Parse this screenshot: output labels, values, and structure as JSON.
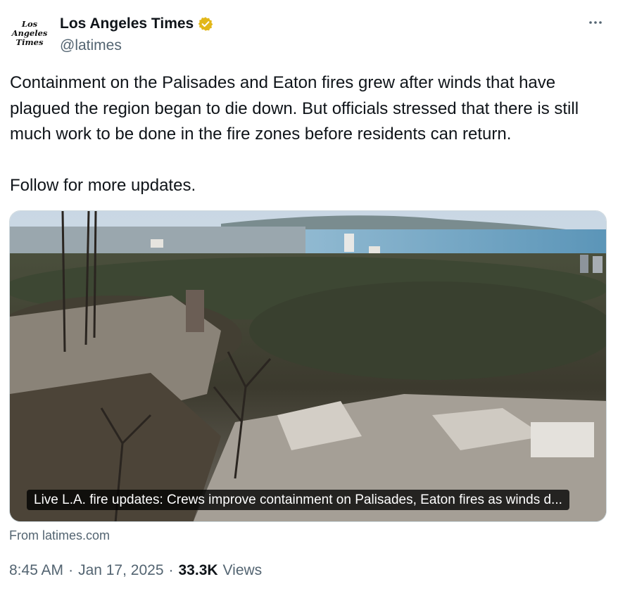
{
  "author": {
    "logo_lines": [
      "Los",
      "Angeles",
      "Times"
    ],
    "display_name": "Los Angeles Times",
    "handle": "@latimes",
    "verified_badge": "gold-verified-icon",
    "badge_color": "#e2b719"
  },
  "tweet": {
    "paragraphs": [
      "Containment on the Palisades and Eaton fires grew after winds that have plagued the region began to die down. But officials stressed that there is still much work to be done in the fire zones before residents can return.",
      "Follow for more updates."
    ]
  },
  "card": {
    "caption": "Live L.A. fire updates: Crews improve containment on Palisades, Eaton fires as winds d...",
    "source": "From latimes.com"
  },
  "meta": {
    "time": "8:45 AM",
    "separator": "·",
    "date": "Jan 17, 2025",
    "views_count": "33.3K",
    "views_label": "Views"
  },
  "colors": {
    "text": "#0f1419",
    "secondary": "#536471",
    "border": "#cfd9de"
  }
}
